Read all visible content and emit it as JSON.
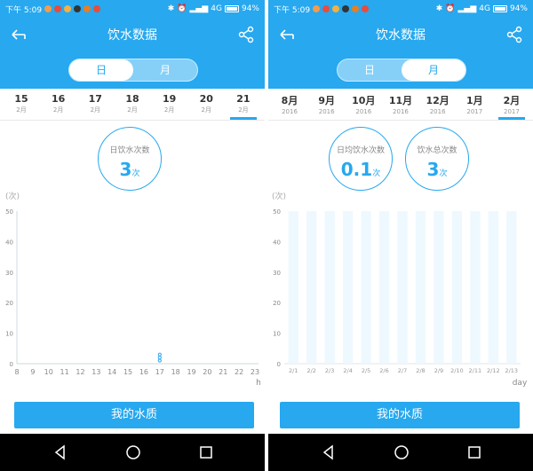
{
  "status": {
    "time": "下午 5:09",
    "network": "4G",
    "battery": "94%",
    "notif_colors": [
      "#f39c4d",
      "#e74c3c",
      "#f5b041",
      "#333333",
      "#e67e22",
      "#e74c3c"
    ]
  },
  "left": {
    "title": "饮水数据",
    "toggle": {
      "day_label": "日",
      "month_label": "月",
      "active": "day"
    },
    "dates": [
      {
        "big": "15",
        "small": "2月"
      },
      {
        "big": "16",
        "small": "2月"
      },
      {
        "big": "17",
        "small": "2月"
      },
      {
        "big": "18",
        "small": "2月"
      },
      {
        "big": "19",
        "small": "2月"
      },
      {
        "big": "20",
        "small": "2月"
      },
      {
        "big": "21",
        "small": "2月",
        "selected": true
      }
    ],
    "stat": {
      "label": "日饮水次数",
      "value": "3",
      "unit": "次"
    },
    "button": "我的水质"
  },
  "right": {
    "title": "饮水数据",
    "toggle": {
      "day_label": "日",
      "month_label": "月",
      "active": "month"
    },
    "dates": [
      {
        "big": "8月",
        "small": "2016"
      },
      {
        "big": "9月",
        "small": "2016"
      },
      {
        "big": "10月",
        "small": "2016"
      },
      {
        "big": "11月",
        "small": "2016"
      },
      {
        "big": "12月",
        "small": "2016"
      },
      {
        "big": "1月",
        "small": "2017"
      },
      {
        "big": "2月",
        "small": "2017",
        "selected": true
      }
    ],
    "stat1": {
      "label": "日均饮水次数",
      "value": "0.1",
      "unit": "次"
    },
    "stat2": {
      "label": "饮水总次数",
      "value": "3",
      "unit": "次"
    },
    "button": "我的水质"
  },
  "chart_data": [
    {
      "type": "line",
      "ylabel": "(次)",
      "xlabel": "h",
      "ylim": [
        0,
        50
      ],
      "yticks": [
        0,
        10,
        20,
        30,
        40,
        50
      ],
      "x": [
        8,
        9,
        10,
        11,
        12,
        13,
        14,
        15,
        16,
        17,
        18,
        19,
        20,
        21,
        22,
        23
      ],
      "series": [
        {
          "points": [
            [
              17,
              1
            ],
            [
              17,
              2
            ],
            [
              17,
              3
            ]
          ]
        }
      ],
      "color": "#27a8ef"
    },
    {
      "type": "bar",
      "ylabel": "(次)",
      "xlabel": "day",
      "ylim": [
        0,
        50
      ],
      "yticks": [
        0,
        10,
        20,
        30,
        40,
        50
      ],
      "categories": [
        "2/1",
        "2/2",
        "2/3",
        "2/4",
        "2/5",
        "2/6",
        "2/7",
        "2/8",
        "2/9",
        "2/10",
        "2/11",
        "2/12",
        "2/13"
      ],
      "background_bars": [
        50,
        50,
        50,
        50,
        50,
        50,
        50,
        50,
        50,
        50,
        50,
        50,
        50
      ],
      "values": [
        0,
        0,
        0,
        0,
        0,
        0,
        0,
        0,
        0,
        0,
        0,
        0,
        0
      ],
      "bg_color": "#eef8ff"
    }
  ]
}
